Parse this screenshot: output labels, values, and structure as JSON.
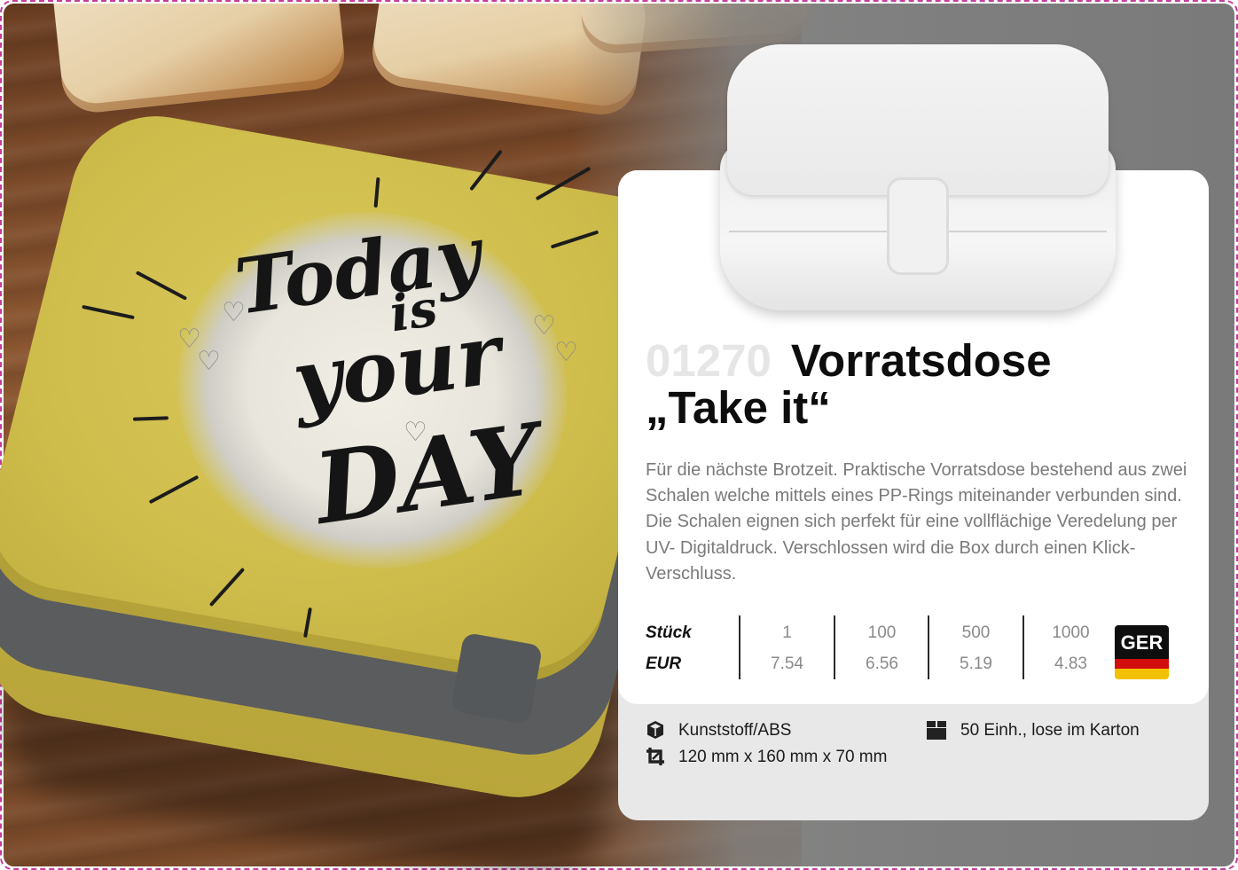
{
  "product": {
    "number": "01270",
    "title_line1": "Vorratsdose",
    "title_line2": "„Take it“",
    "description": "Für die nächste Brotzeit. Praktische Vorratsdose bestehend aus zwei Schalen welche mittels eines PP-Rings miteinander ver­bunden sind. Die Schalen eignen sich perfekt für eine vollflächi­ge Veredelung per UV- Digitaldruck. Verschlossen wird die Box durch einen Klick-Verschluss."
  },
  "lid_print": {
    "line1": "Today",
    "line2": "is",
    "line3": "your",
    "line4": "DAY"
  },
  "prices": {
    "quantity_label": "Stück",
    "currency_label": "EUR",
    "quantities": [
      "1",
      "100",
      "500",
      "1000"
    ],
    "values": [
      "7.54",
      "6.56",
      "5.19",
      "4.83"
    ]
  },
  "origin": {
    "code": "GER",
    "flag_colors": [
      "#0e0e0e",
      "#d20d0d",
      "#f2c200"
    ]
  },
  "specs": {
    "material": "Kunststoff/ABS",
    "material_icon": "cube-icon",
    "dimensions": "120 mm x 160 mm x 70 mm",
    "dimensions_icon": "crop-icon",
    "packaging": "50 Einh., lose im Karton",
    "packaging_icon": "box-icon"
  },
  "colors": {
    "lid_yellow": "#cfbd4c",
    "title_number_gray": "#e6e6e6",
    "description_gray": "#7a7a7a",
    "trim_line": "#c63a9a"
  }
}
